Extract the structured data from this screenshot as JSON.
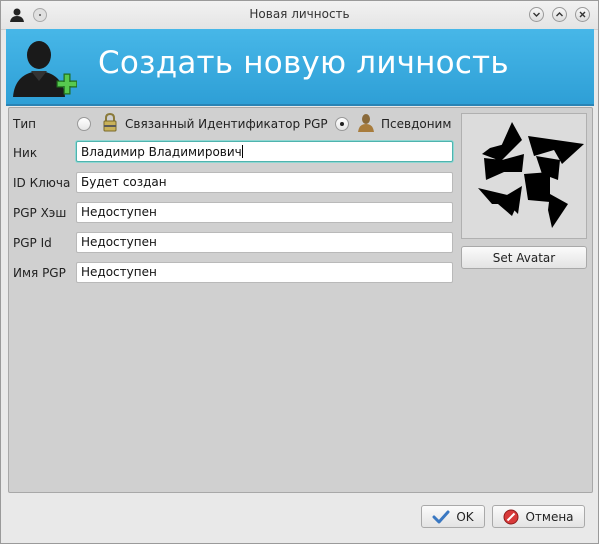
{
  "window": {
    "title": "Новая личность"
  },
  "header": {
    "title": "Создать новую личность"
  },
  "form": {
    "type_label": "Тип",
    "type_options": [
      {
        "label": "Связанный Идентификатор PGP",
        "selected": false
      },
      {
        "label": "Псевдоним",
        "selected": true
      }
    ],
    "nick_label": "Ник",
    "nick_value": "Владимир Владимирович",
    "key_id_label": "ID Ключа",
    "key_id_value": "Будет создан",
    "pgp_hash_label": "PGP Хэш",
    "pgp_hash_value": "Недоступен",
    "pgp_id_label": "PGP Id",
    "pgp_id_value": "Недоступен",
    "pgp_name_label": "Имя PGP",
    "pgp_name_value": "Недоступен"
  },
  "avatar": {
    "set_label": "Set Avatar"
  },
  "buttons": {
    "ok_label": "OK",
    "cancel_label": "Отмена"
  },
  "colors": {
    "header_bg": "#3aaee3",
    "focus_border": "#4fb3ae",
    "ok_check": "#3a78c2",
    "cancel_red": "#d83a3a"
  }
}
